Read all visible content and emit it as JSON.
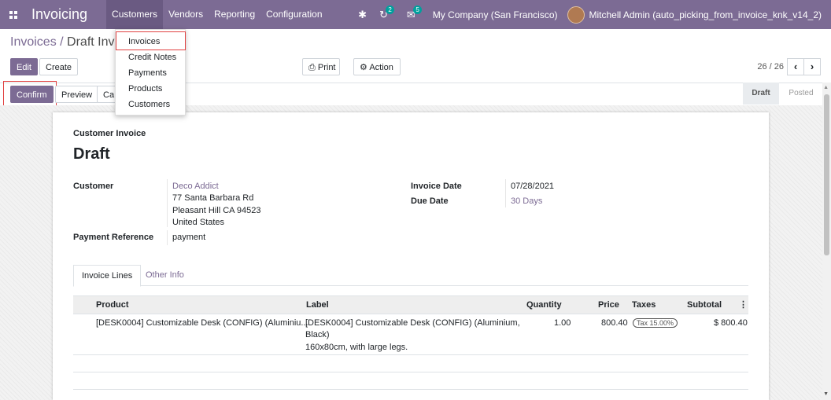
{
  "navbar": {
    "app_title": "Invoicing",
    "menus": [
      "Customers",
      "Vendors",
      "Reporting",
      "Configuration"
    ],
    "activity_count": "2",
    "messages_count": "5",
    "company": "My Company (San Francisco)",
    "user": "Mitchell Admin (auto_picking_from_invoice_knk_v14_2)"
  },
  "breadcrumb": {
    "parent": "Invoices",
    "sep": " / ",
    "current": "Draft Invoi"
  },
  "buttons": {
    "edit": "Edit",
    "create": "Create",
    "print": "Print",
    "action": "Action",
    "confirm": "Confirm",
    "preview": "Preview",
    "cancel_partial": "Ca"
  },
  "pager": {
    "text": "26 / 26"
  },
  "status": {
    "draft": "Draft",
    "posted": "Posted"
  },
  "dropdown": [
    "Invoices",
    "Credit Notes",
    "Payments",
    "Products",
    "Customers"
  ],
  "invoice": {
    "type": "Customer Invoice",
    "state": "Draft",
    "customer_label": "Customer",
    "customer_name": "Deco Addict",
    "address1": "77 Santa Barbara Rd",
    "address2": "Pleasant Hill CA 94523",
    "address3": "United States",
    "payment_ref_label": "Payment Reference",
    "payment_ref": "payment",
    "invoice_date_label": "Invoice Date",
    "invoice_date": "07/28/2021",
    "due_date_label": "Due Date",
    "due_date": "30 Days"
  },
  "tabs": {
    "lines": "Invoice Lines",
    "other": "Other Info"
  },
  "table": {
    "headers": {
      "product": "Product",
      "label": "Label",
      "quantity": "Quantity",
      "price": "Price",
      "taxes": "Taxes",
      "subtotal": "Subtotal"
    },
    "row": {
      "product": "[DESK0004] Customizable Desk (CONFIG) (Aluminiu...",
      "label1": "[DESK0004] Customizable Desk (CONFIG) (Aluminium,",
      "label2": "Black)",
      "label3": "160x80cm, with large legs.",
      "quantity": "1.00",
      "price": "800.40",
      "tax": "Tax 15.00%",
      "subtotal": "$ 800.40"
    }
  }
}
